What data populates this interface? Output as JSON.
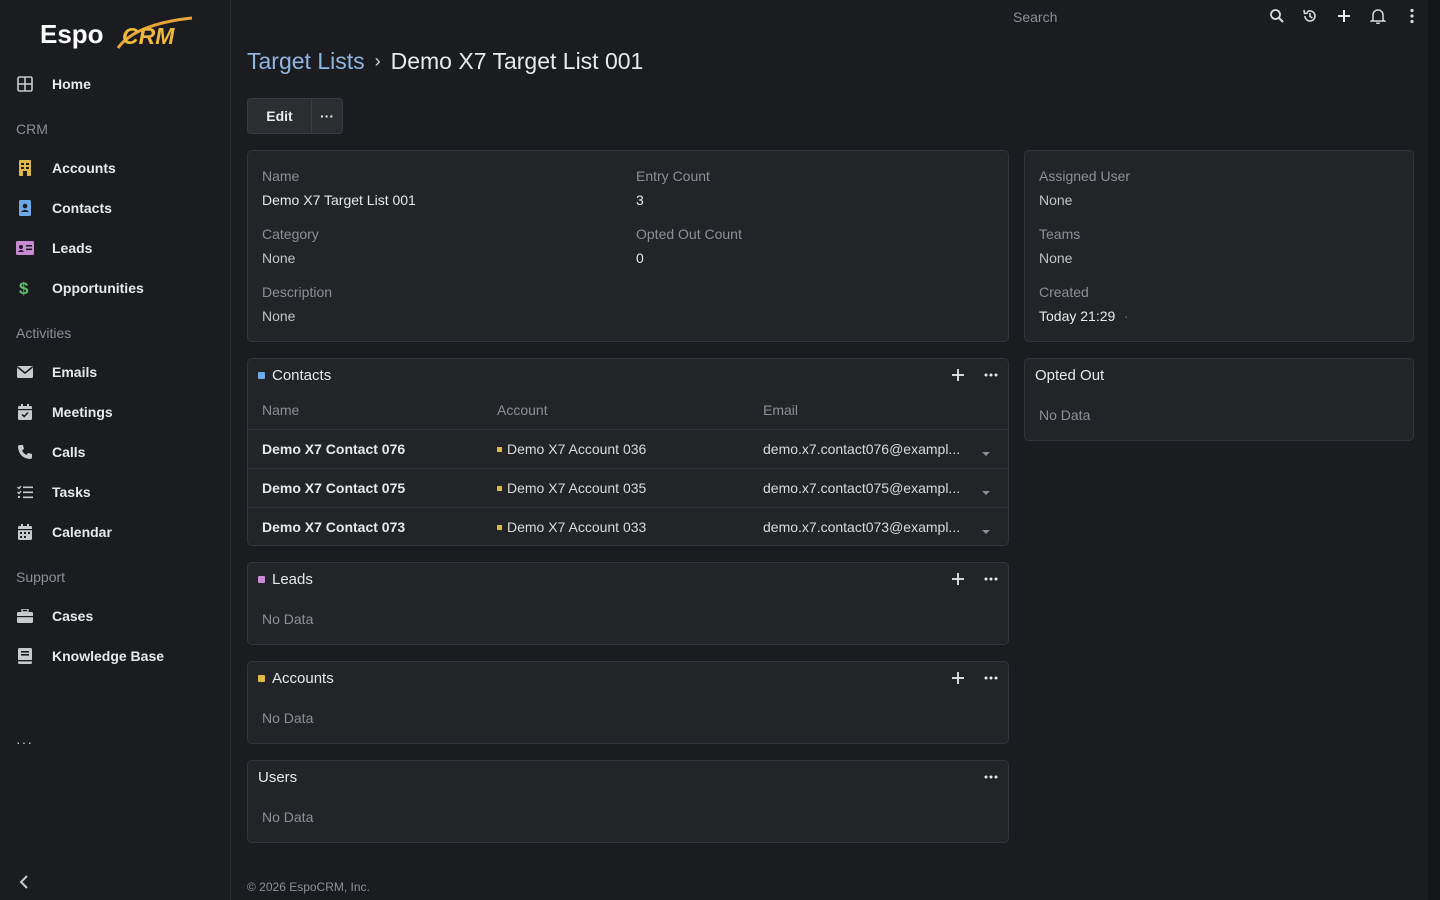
{
  "brand": {
    "logo_text_1": "Espo",
    "logo_text_2": "CRM"
  },
  "sidebar": {
    "home": "Home",
    "groups": {
      "crm": "CRM",
      "activities": "Activities",
      "support": "Support"
    },
    "crm_items": [
      "Accounts",
      "Contacts",
      "Leads",
      "Opportunities"
    ],
    "activity_items": [
      "Emails",
      "Meetings",
      "Calls",
      "Tasks",
      "Calendar"
    ],
    "support_items": [
      "Cases",
      "Knowledge Base"
    ],
    "more": "···"
  },
  "topbar": {
    "search_placeholder": "Search"
  },
  "header": {
    "breadcrumb_parent": "Target Lists",
    "breadcrumb_sep": "›",
    "title": "Demo X7 Target List 001",
    "edit_label": "Edit",
    "more_label": "···"
  },
  "details": {
    "name_label": "Name",
    "name_value": "Demo X7 Target List 001",
    "entry_count_label": "Entry Count",
    "entry_count_value": "3",
    "category_label": "Category",
    "category_value": "None",
    "opted_out_count_label": "Opted Out Count",
    "opted_out_count_value": "0",
    "description_label": "Description",
    "description_value": "None"
  },
  "side_panel": {
    "assigned_user_label": "Assigned User",
    "assigned_user_value": "None",
    "teams_label": "Teams",
    "teams_value": "None",
    "created_label": "Created",
    "created_value": "Today 21:29",
    "created_dot": "·"
  },
  "opted_out": {
    "title": "Opted Out",
    "empty": "No Data"
  },
  "contacts": {
    "title": "Contacts",
    "columns": [
      "Name",
      "Account",
      "Email"
    ],
    "rows": [
      {
        "name": "Demo X7 Contact 076",
        "account": "Demo X7 Account 036",
        "email": "demo.x7.contact076@exampl..."
      },
      {
        "name": "Demo X7 Contact 075",
        "account": "Demo X7 Account 035",
        "email": "demo.x7.contact075@exampl..."
      },
      {
        "name": "Demo X7 Contact 073",
        "account": "Demo X7 Account 033",
        "email": "demo.x7.contact073@exampl..."
      }
    ]
  },
  "leads": {
    "title": "Leads",
    "empty": "No Data"
  },
  "accounts": {
    "title": "Accounts",
    "empty": "No Data"
  },
  "users": {
    "title": "Users",
    "empty": "No Data"
  },
  "footer": {
    "text": "© 2026 EspoCRM, Inc."
  },
  "colors": {
    "contacts_marker": "#6ea8e6",
    "leads_marker": "#c98ad4",
    "accounts_marker": "#e0b945",
    "link": "#8fb6e3"
  }
}
